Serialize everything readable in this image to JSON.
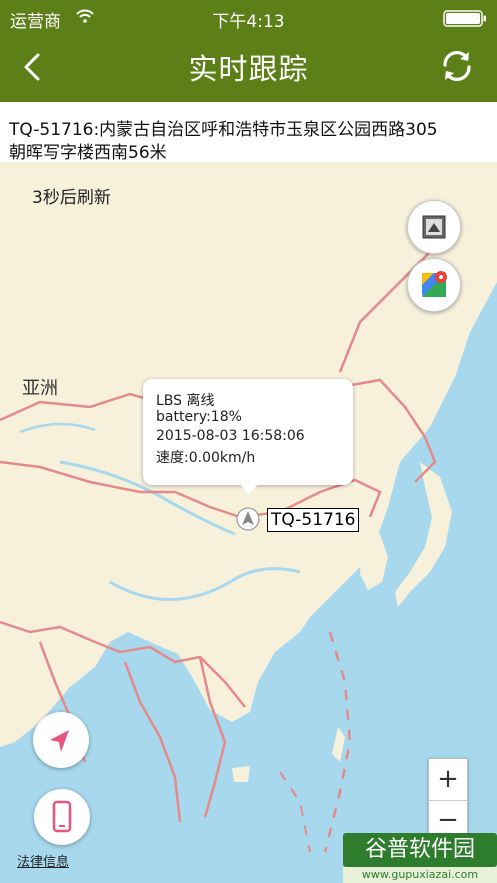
{
  "status_bar": {
    "carrier": "运营商",
    "time": "下午4:13"
  },
  "nav": {
    "title": "实时跟踪"
  },
  "address": {
    "line1": "TQ-51716:内蒙古自治区呼和浩特市玉泉区公园西路305",
    "line2": "朝晖写字楼西南56米"
  },
  "map": {
    "countdown": "3秒后刷新",
    "region_label": "亚洲",
    "popup": {
      "status": "LBS 离线",
      "battery": "battery:18%",
      "datetime": "2015-08-03 16:58:06",
      "speed": "速度:0.00km/h"
    },
    "device_label": "TQ-51716",
    "legal_link": "法律信息",
    "zoom_in": "+",
    "zoom_out": "−"
  },
  "watermark": {
    "brand": "谷普软件园",
    "url": "www.gupuxiazai.com"
  },
  "colors": {
    "header": "#5c7f17",
    "land": "#f7f1dc",
    "water": "#a7d8ee",
    "border": "#e58a8a",
    "accent": "#e8547a"
  },
  "icons": [
    "back-chevron-icon",
    "refresh-icon",
    "wifi-icon",
    "battery-icon",
    "map-type-icon",
    "google-maps-icon",
    "navigation-arrow-icon",
    "locate-arrow-icon",
    "phone-icon"
  ]
}
